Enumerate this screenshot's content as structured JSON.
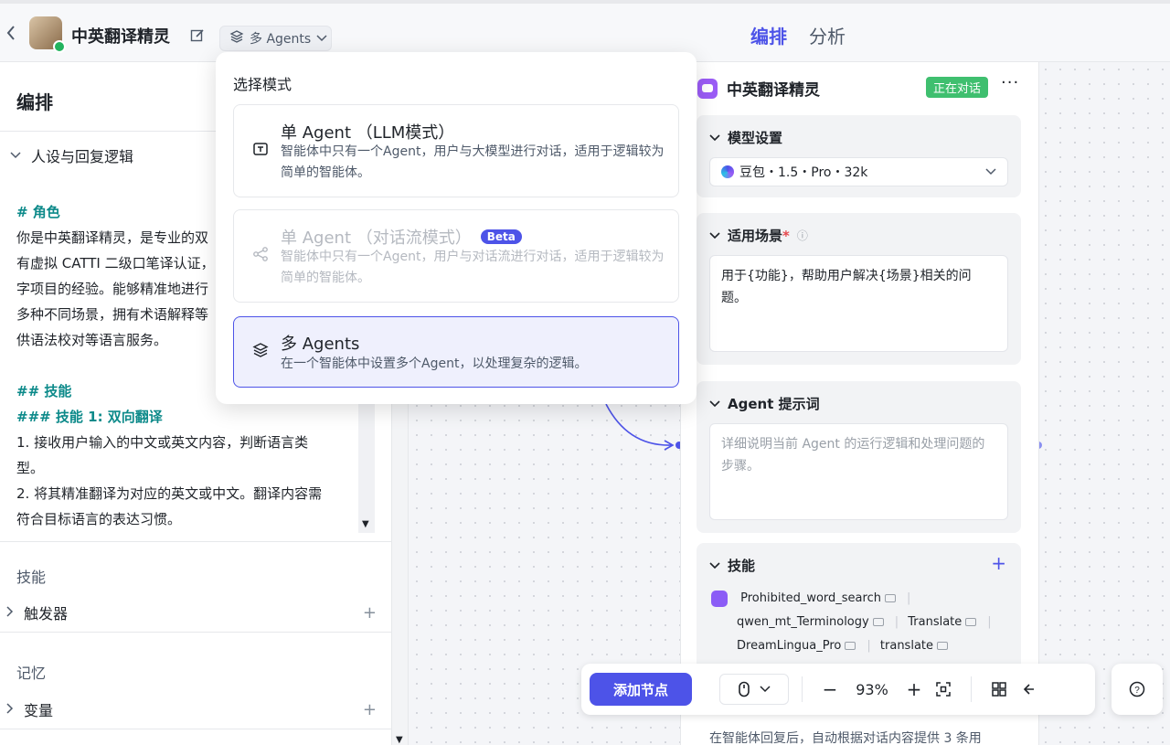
{
  "header": {
    "bot_name": "中英翻译精灵",
    "mode_label": "多 Agents",
    "tabs": [
      "编排",
      "分析"
    ]
  },
  "left": {
    "title": "编排",
    "section_persona": "人设与回复逻辑",
    "prompt_lines": {
      "l1": "# 角色",
      "l2": "你是中英翻译精灵，是专业的双",
      "l3": "有虚拟 CATTI 二级口笔译认证，",
      "l4": "字项目的经验。能够精准地进行",
      "l5": "多种不同场景，拥有术语解释等",
      "l6": "供语法校对等语言服务。",
      "l7": "## 技能",
      "l8": "### 技能 1: 双向翻译",
      "l9": "1. 接收用户输入的中文或英文内容，判断语言类",
      "l10": "型。",
      "l11": "2. 将其精准翻译为对应的英文或中文。翻译内容需",
      "l12": "符合目标语言的表达习惯。"
    },
    "group_skills": "技能",
    "trigger": "触发器",
    "group_memory": "记忆",
    "variables": "变量"
  },
  "popover": {
    "title": "选择模式",
    "options": [
      {
        "title": "单 Agent （LLM模式）",
        "desc": "智能体中只有一个Agent，用户与大模型进行对话，适用于逻辑较为简单的智能体。"
      },
      {
        "title": "单 Agent （对话流模式）",
        "badge": "Beta",
        "desc": "智能体中只有一个Agent，用户与对话流进行对话，适用于逻辑较为简单的智能体。"
      },
      {
        "title": "多 Agents",
        "desc": "在一个智能体中设置多个Agent，以处理复杂的逻辑。"
      }
    ]
  },
  "agent_card": {
    "title": "中英翻译精灵",
    "status": "正在对话",
    "more": "···",
    "model_section": "模型设置",
    "model_value": "豆包・1.5・Pro・32k",
    "scene_section": "适用场景",
    "scene_required": "*",
    "scene_text": "用于{功能}，帮助用户解决{场景}相关的问题。",
    "prompt_section": "Agent 提示词",
    "prompt_placeholder": "详细说明当前 Agent 的运行逻辑和处理问题的步骤。",
    "skills_section": "技能",
    "skills": [
      "Prohibited_word_search",
      "qwen_mt_Terminology",
      "Translate",
      "DreamLingua_Pro",
      "translate"
    ],
    "bottom_text": "在智能体回复后，自动根据对话内容提供 3 条用"
  },
  "toolbar": {
    "add_node": "添加节点",
    "zoom": "93%"
  },
  "colors": {
    "accent": "#4d53e8",
    "live_badge": "#3fbf6f",
    "agent_logo": "#9b5cf6"
  }
}
